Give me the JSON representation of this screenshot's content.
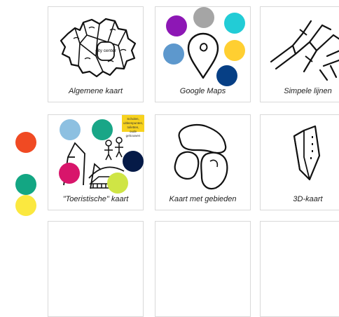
{
  "cards": [
    {
      "id": "algemene",
      "label": "Algemene kaart",
      "city_text": "city center"
    },
    {
      "id": "google",
      "label": "Google Maps"
    },
    {
      "id": "lijnen",
      "label": "Simpele lijnen"
    },
    {
      "id": "toeristisch",
      "label": "\"Toeristische\" kaart",
      "sticky": "Scholen, uitleenpunten, toiletten, oude gebouwen"
    },
    {
      "id": "gebieden",
      "label": "Kaart met gebieden"
    },
    {
      "id": "3d",
      "label": "3D-kaart"
    },
    {
      "id": "empty1",
      "label": ""
    },
    {
      "id": "empty2",
      "label": ""
    },
    {
      "id": "empty3",
      "label": ""
    }
  ],
  "colors": {
    "purple": "#8d17b5",
    "gray": "#a5a5a5",
    "cyan": "#22ccd6",
    "lightblue": "#5d98cd",
    "yellow": "#ffcf31",
    "navy": "#063f85",
    "sky": "#8dc0e1",
    "teal": "#19a687",
    "magenta": "#d8156b",
    "darknavy": "#051a47",
    "lime": "#cfe545",
    "red": "#f04a23",
    "green": "#13a683",
    "lemon": "#fbe83f"
  },
  "side_dots": [
    "red",
    "green",
    "lemon"
  ]
}
